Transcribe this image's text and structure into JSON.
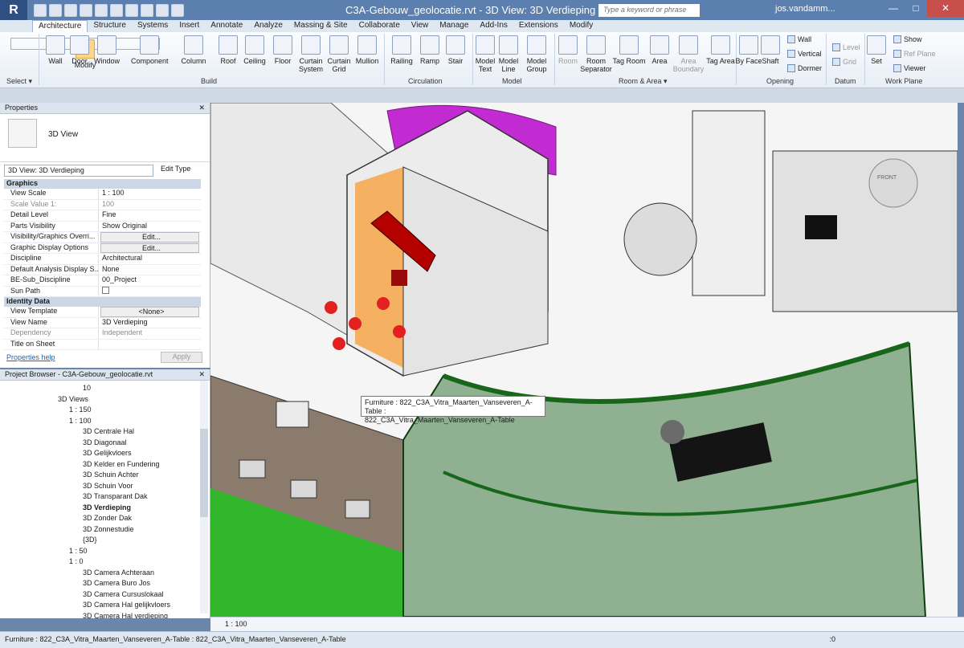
{
  "app": {
    "logo": "R",
    "title": "C3A-Gebouw_geolocatie.rvt - 3D View: 3D Verdieping",
    "search_placeholder": "Type a keyword or phrase",
    "user": "jos.vandamm..."
  },
  "window": {
    "minimize": "—",
    "maximize": "□",
    "close": "✕"
  },
  "tabs": [
    "Architecture",
    "Structure",
    "Systems",
    "Insert",
    "Annotate",
    "Analyze",
    "Massing & Site",
    "Collaborate",
    "View",
    "Manage",
    "Add-Ins",
    "Extensions",
    "Modify"
  ],
  "ribbon": {
    "buttons": [
      "Modify",
      "Wall",
      "Door",
      "Window",
      "Component",
      "Column",
      "Roof",
      "Ceiling",
      "Floor",
      "Curtain System",
      "Curtain Grid",
      "Mullion",
      "Railing",
      "Ramp",
      "Stair",
      "Model Text",
      "Model Line",
      "Model Group",
      "Room",
      "Room Separator",
      "Tag Room",
      "Area",
      "Area Boundary",
      "Tag Area",
      "By Face",
      "Shaft",
      "Set"
    ],
    "small": [
      "Wall",
      "Vertical",
      "Dormer",
      "Level",
      "Grid",
      "Show",
      "Ref Plane",
      "Viewer"
    ],
    "groups": [
      "Select ▾",
      "Build",
      "Circulation",
      "Model",
      "Room & Area ▾",
      "Opening",
      "Datum",
      "Work Plane"
    ]
  },
  "properties": {
    "title": "Properties",
    "type": "3D View",
    "selector": "3D View: 3D Verdieping",
    "edit_type": "Edit Type",
    "sections": [
      {
        "name": "Graphics",
        "rows": [
          [
            "View Scale",
            "1 : 100"
          ],
          [
            "Scale Value    1:",
            "100"
          ],
          [
            "Detail Level",
            "Fine"
          ],
          [
            "Parts Visibility",
            "Show Original"
          ],
          [
            "Visibility/Graphics Overri...",
            "Edit..."
          ],
          [
            "Graphic Display Options",
            "Edit..."
          ],
          [
            "Discipline",
            "Architectural"
          ],
          [
            "Default Analysis Display S...",
            "None"
          ],
          [
            "BE-Sub_Discipline",
            "00_Project"
          ],
          [
            "Sun Path",
            ""
          ]
        ]
      },
      {
        "name": "Identity Data",
        "rows": [
          [
            "View Template",
            "<None>"
          ],
          [
            "View Name",
            "3D Verdieping"
          ],
          [
            "Dependency",
            "Independent"
          ],
          [
            "Title on Sheet",
            ""
          ]
        ]
      }
    ],
    "help": "Properties help",
    "apply": "Apply"
  },
  "browser": {
    "title": "Project Browser - C3A-Gebouw_geolocatie.rvt",
    "nodes": [
      "10",
      "3D Views",
      "1 : 150",
      "1 : 100",
      "3D Centrale Hal",
      "3D Diagonaal",
      "3D Gelijkvloers",
      "3D Kelder en Fundering",
      "3D Schuin Achter",
      "3D Schuin Voor",
      "3D Transparant Dak",
      "3D Verdieping",
      "3D Zonder Dak",
      "3D Zonnestudie",
      "{3D}",
      "1 : 50",
      "1 : 0",
      "3D Camera Achteraan",
      "3D Camera Buro Jos",
      "3D Camera Cursuslokaal",
      "3D Camera Hal gelijkvloers",
      "3D Camera Hal verdieping"
    ]
  },
  "viewport": {
    "tooltip_line1": "Furniture : 822_C3A_Vitra_Maarten_Vanseveren_A-Table :",
    "tooltip_line2": "822_C3A_Vitra_Maarten_Vanseveren_A-Table",
    "scale": "1 : 100",
    "viewcube": "FRONT"
  },
  "status": {
    "text": "Furniture : 822_C3A_Vitra_Maarten_Vanseveren_A-Table : 822_C3A_Vitra_Maarten_Vanseveren_A-Table",
    "zero": ":0"
  }
}
